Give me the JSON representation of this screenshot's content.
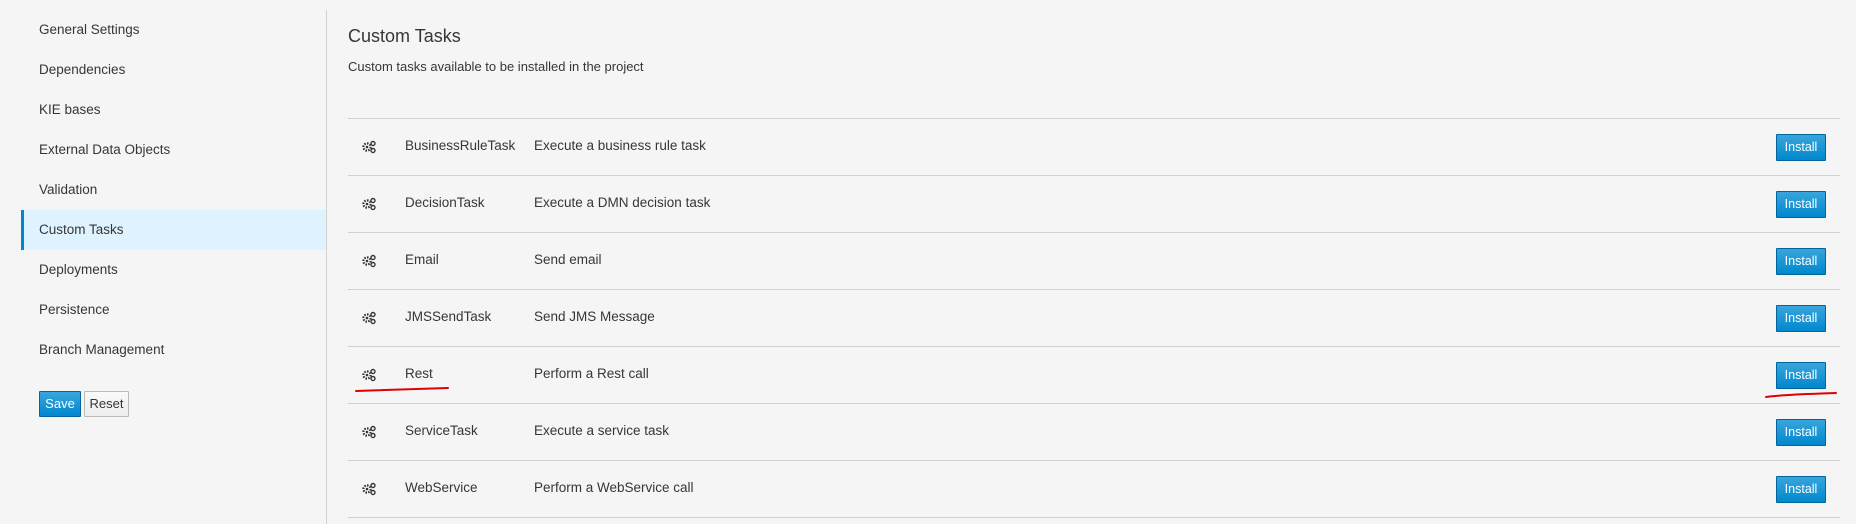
{
  "sidebar": {
    "items": [
      {
        "label": "General Settings",
        "active": false
      },
      {
        "label": "Dependencies",
        "active": false
      },
      {
        "label": "KIE bases",
        "active": false
      },
      {
        "label": "External Data Objects",
        "active": false
      },
      {
        "label": "Validation",
        "active": false
      },
      {
        "label": "Custom Tasks",
        "active": true
      },
      {
        "label": "Deployments",
        "active": false
      },
      {
        "label": "Persistence",
        "active": false
      },
      {
        "label": "Branch Management",
        "active": false
      }
    ],
    "save_label": "Save",
    "reset_label": "Reset"
  },
  "main": {
    "title": "Custom Tasks",
    "subtitle": "Custom tasks available to be installed in the project",
    "tasks": [
      {
        "name": "BusinessRuleTask",
        "description": "Execute a business rule task",
        "action_label": "Install",
        "icon": "gears-icon"
      },
      {
        "name": "DecisionTask",
        "description": "Execute a DMN decision task",
        "action_label": "Install",
        "icon": "gears-icon"
      },
      {
        "name": "Email",
        "description": "Send email",
        "action_label": "Install",
        "icon": "gears-icon"
      },
      {
        "name": "JMSSendTask",
        "description": "Send JMS Message",
        "action_label": "Install",
        "icon": "gears-icon"
      },
      {
        "name": "Rest",
        "description": "Perform a Rest call",
        "action_label": "Install",
        "icon": "gears-icon"
      },
      {
        "name": "ServiceTask",
        "description": "Execute a service task",
        "action_label": "Install",
        "icon": "gears-icon"
      },
      {
        "name": "WebService",
        "description": "Perform a WebService call",
        "action_label": "Install",
        "icon": "gears-icon"
      }
    ]
  },
  "colors": {
    "accent": "#0088ce",
    "active_bg": "#def3ff",
    "annotation": "#e00000"
  }
}
